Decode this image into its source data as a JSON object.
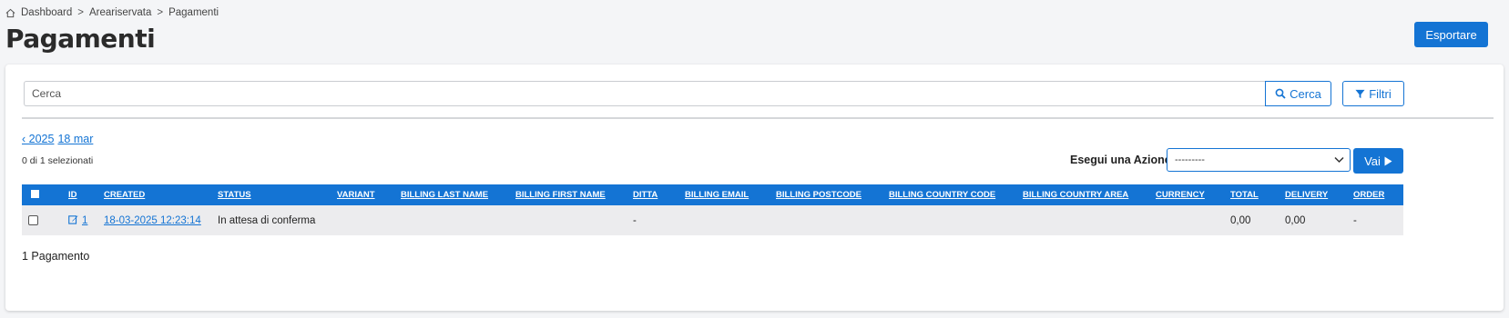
{
  "breadcrumb": {
    "items": [
      "Dashboard",
      "Areariservata",
      "Pagamenti"
    ],
    "separator": ">"
  },
  "page": {
    "title": "Pagamenti",
    "export_label": "Esportare"
  },
  "search": {
    "placeholder": "Cerca",
    "button_label": "Cerca",
    "filters_label": "Filtri"
  },
  "date_nav": {
    "year_link": "‹ 2025",
    "day_link": "18 mar"
  },
  "selection": {
    "count_text": "0 di 1 selezionati"
  },
  "actions": {
    "label": "Esegui una Azione:",
    "selected": "---------",
    "go_label": "Vai"
  },
  "table": {
    "columns": [
      "ID",
      "CREATED",
      "STATUS",
      "VARIANT",
      "BILLING LAST NAME",
      "BILLING FIRST NAME",
      "DITTA",
      "BILLING EMAIL",
      "BILLING POSTCODE",
      "BILLING COUNTRY CODE",
      "BILLING COUNTRY AREA",
      "CURRENCY",
      "TOTAL",
      "DELIVERY",
      "ORDER"
    ],
    "rows": [
      {
        "id": "1",
        "created": "18-03-2025 12:23:14",
        "status": "In attesa di conferma",
        "variant": "",
        "billing_last_name": "",
        "billing_first_name": "",
        "ditta": "-",
        "billing_email": "",
        "billing_postcode": "",
        "billing_country_code": "",
        "billing_country_area": "",
        "currency": "",
        "total": "0,00",
        "delivery": "0,00",
        "order": "-"
      }
    ]
  },
  "footer": {
    "count_text": "1 Pagamento"
  },
  "colors": {
    "accent": "#1474d4",
    "background": "#f4f5f7",
    "row_bg": "#ececee"
  },
  "icons": {
    "home": "home-icon",
    "search": "search-icon",
    "filter": "filter-icon",
    "play": "play-icon",
    "edit": "edit-icon",
    "chevron": "chevron-down-icon"
  }
}
